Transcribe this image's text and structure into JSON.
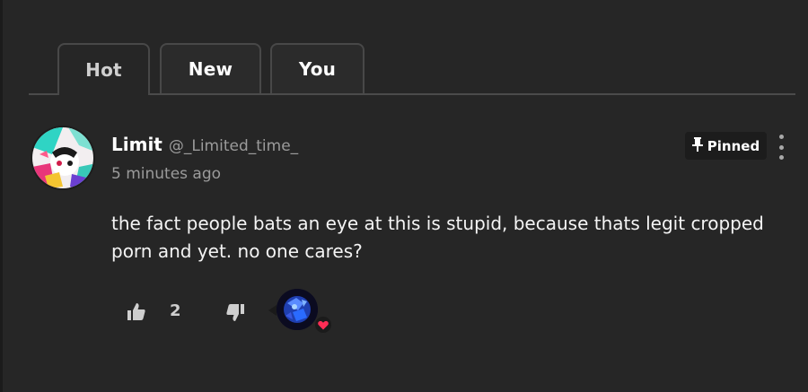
{
  "tabs": [
    {
      "label": "Hot",
      "active": true
    },
    {
      "label": "New",
      "active": false
    },
    {
      "label": "You",
      "active": false
    }
  ],
  "comment": {
    "author_name": "Limit",
    "author_handle": "@_Limited_time_",
    "timestamp": "5 minutes ago",
    "pinned_label": "Pinned",
    "body": "the fact people bats an eye at this is stupid, because thats legit cropped porn and yet. no one cares?",
    "like_count": "2"
  },
  "icons": {
    "pin": "pin-icon",
    "more": "more-vertical-icon",
    "like": "thumbs-up-icon",
    "dislike": "thumbs-down-icon",
    "heart": "heart-icon"
  },
  "colors": {
    "background": "#262626",
    "heart": "#ff2d55",
    "muted_text": "#9b9b9b"
  }
}
